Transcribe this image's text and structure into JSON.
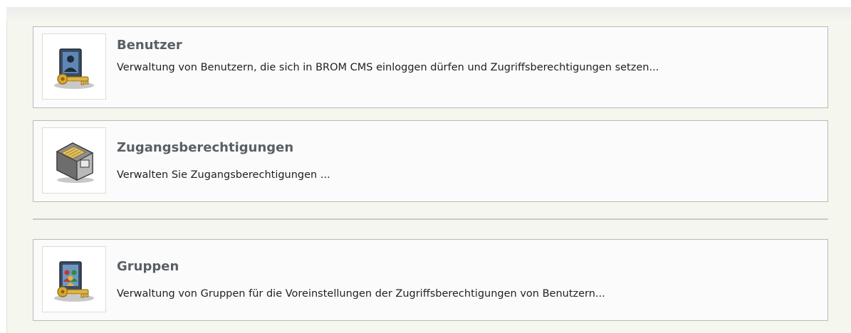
{
  "items": [
    {
      "title": "Benutzer",
      "description": "Verwaltung von Benutzern, die sich in BROM CMS einloggen dürfen und Zugriffsberechtigungen setzen...",
      "icon": "user-card-key-icon"
    },
    {
      "title": "Zugangsberechtigungen",
      "description": "Verwalten Sie Zugangsberechtigungen ...",
      "icon": "file-cabinet-drawer-icon"
    },
    {
      "title": "Gruppen",
      "description": "Verwaltung von Gruppen für die Voreinstellungen der Zugriffsberechtigungen von Benutzern...",
      "icon": "group-card-key-icon"
    }
  ],
  "colors": {
    "panel_background": "#f5f6ee",
    "card_border": "#b9bab4",
    "title_text": "#5a5f66"
  }
}
